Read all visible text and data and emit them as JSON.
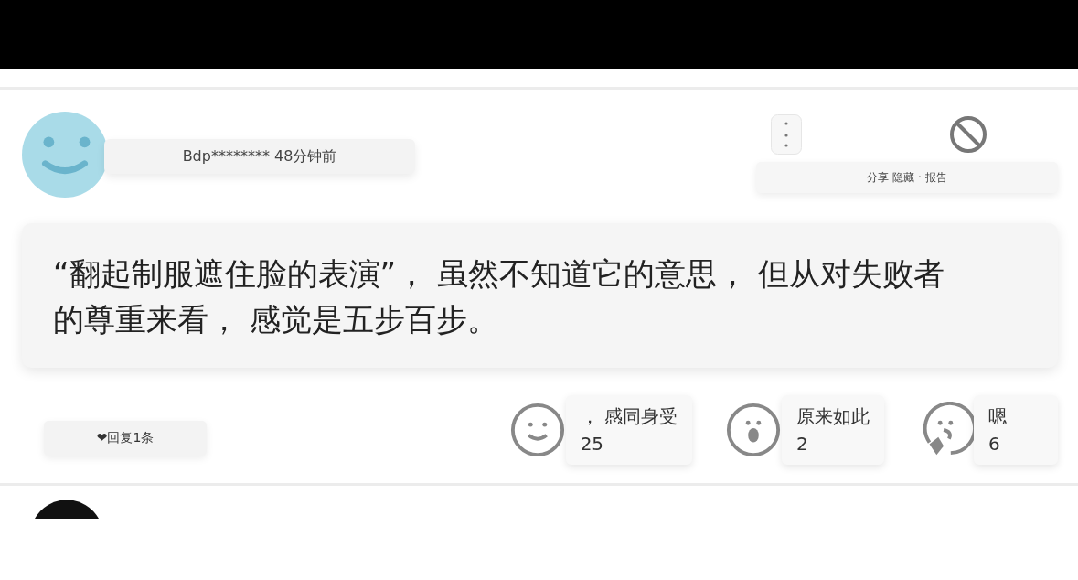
{
  "comment": {
    "user": "Bdp******** 48分钟前",
    "actions": "分享 隐藏 · 报告",
    "text": "“翻起制服遮住脸的表演”， 虽然不知道它的意思， 但从对失败者的尊重来看， 感觉是五步百步。",
    "reply": "❤回复1条",
    "reactions": [
      {
        "kind": "smile",
        "label": "， 感同身受",
        "count": "25"
      },
      {
        "kind": "wow",
        "label": "原来如此",
        "count": "2"
      },
      {
        "kind": "think",
        "label": "嗯",
        "count": "6"
      }
    ]
  }
}
